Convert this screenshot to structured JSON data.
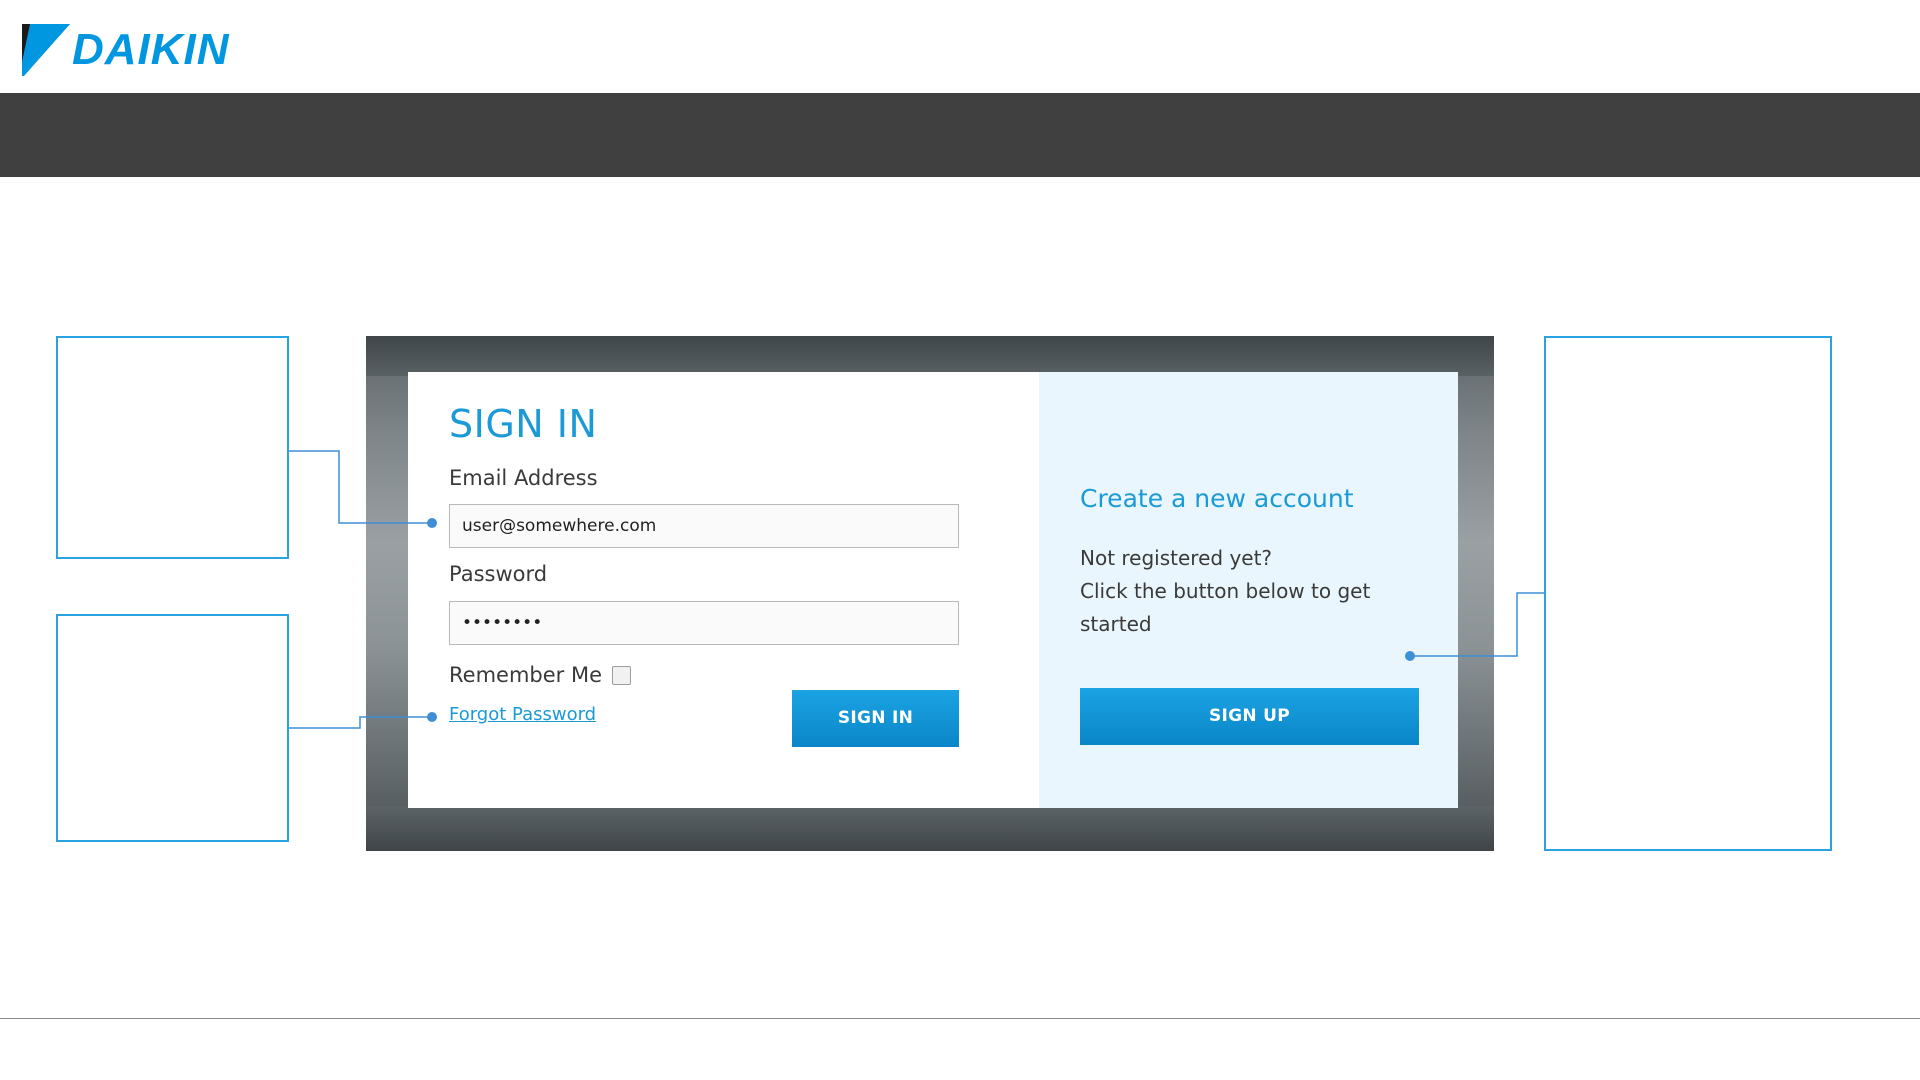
{
  "brand": {
    "logo_text": "DAIKIN",
    "logo_icon": "daikin-triangle-icon",
    "accent_color": "#0097e0",
    "nav_band_color": "#404040"
  },
  "signin": {
    "title": "SIGN IN",
    "email_label": "Email Address",
    "email_value": "user@somewhere.com",
    "password_label": "Password",
    "password_value": "••••••••",
    "remember_label": "Remember Me",
    "remember_checked": false,
    "forgot_link": "Forgot Password",
    "button_label": "SIGN IN"
  },
  "signup": {
    "title": "Create a new account",
    "line1": "Not registered yet?",
    "line2": "Click the button below to get started",
    "button_label": "SIGN UP"
  },
  "colors": {
    "button": "#0a86c8",
    "callout_border": "#2aa4e0",
    "signup_panel": "#eaf6fd"
  }
}
